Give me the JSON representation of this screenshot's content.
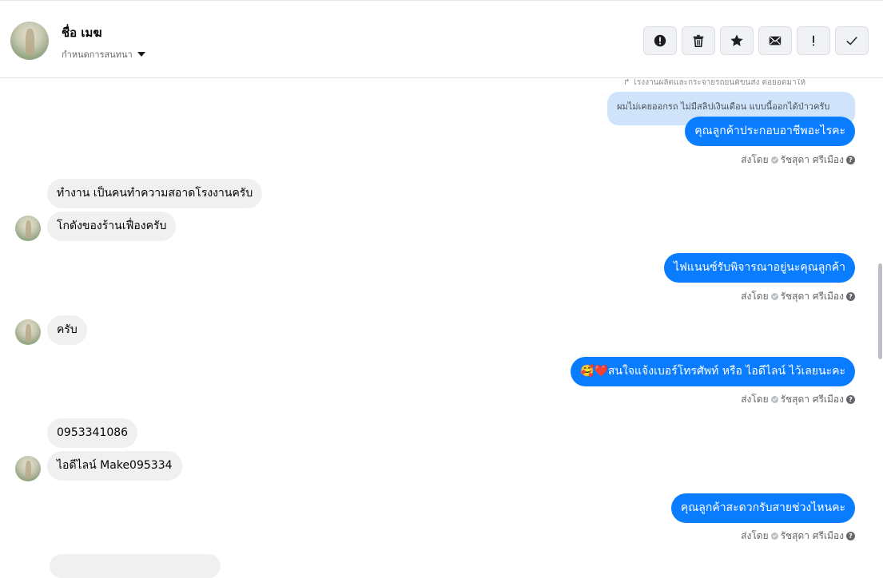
{
  "header": {
    "name": "ชื่อ เมฆ",
    "assign_label": "กำหนดการสนทนา"
  },
  "toolbar": {
    "buttons": [
      {
        "icon": "alert-circle-icon"
      },
      {
        "icon": "trash-icon"
      },
      {
        "icon": "star-icon"
      },
      {
        "icon": "envelope-icon"
      },
      {
        "icon": "exclamation-icon"
      },
      {
        "icon": "check-icon"
      }
    ]
  },
  "thread": {
    "reply_snippet": "↱ โรงงานผลิตและกระจายรถยนต์ขนส่ง ต่อยอดมาให้",
    "reply_quote": "ผมไม่เคยออกรถ ไม่มีสลิปเงินเดือน แบบนี้ออกได้ป่าวครับ",
    "messages": [
      {
        "text": "คุณลูกค้าประกอบอาชีพอะไรคะ",
        "sent_by_prefix": "ส่งโดย",
        "sent_by_name": "รัชสุดา ศรีเมือง"
      },
      {
        "text": "ทำงาน เป็นคนทำความสอาดโรงงานครับ"
      },
      {
        "text": "โกดังของร้านเฟื่องครับ"
      },
      {
        "text": "ไฟแนนซ์รับพิจารณาอยู่นะคุณลูกค้า",
        "sent_by_prefix": "ส่งโดย",
        "sent_by_name": "รัชสุดา ศรีเมือง"
      },
      {
        "text": "ครับ"
      },
      {
        "text": "🥰❤️สนใจแจ้งเบอร์โทรศัพท์ หรือ ไอดีไลน์  ไว้เลยนะคะ",
        "sent_by_prefix": "ส่งโดย",
        "sent_by_name": "รัชสุดา ศรีเมือง"
      },
      {
        "text": "0953341086"
      },
      {
        "text": "ไอดีไลน์   Make095334"
      },
      {
        "text": "คุณลูกค้าสะดวกรับสายช่วงไหนคะ",
        "sent_by_prefix": "ส่งโดย",
        "sent_by_name": "รัชสุดา ศรีเมือง"
      }
    ]
  },
  "colors": {
    "outgoing_bubble": "#0a7cff",
    "incoming_bubble": "#f0f0f0",
    "quote_bubble": "#cfe3fb"
  }
}
